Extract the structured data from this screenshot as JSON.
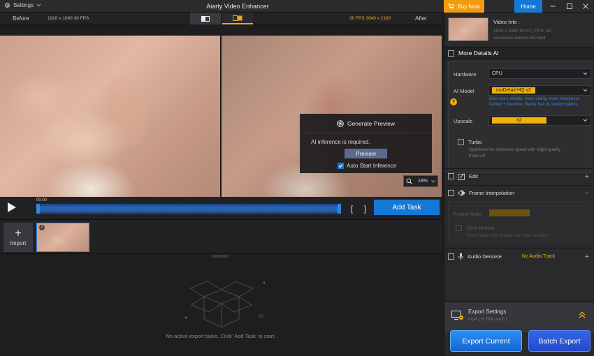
{
  "titlebar": {
    "settings_label": "Settings",
    "app_title": "Aiarty Video Enhancer",
    "buy_now_label": "Buy Now",
    "home_label": "Home"
  },
  "compare": {
    "before_label": "Before",
    "before_info": "1920 x 1080  30 FPS",
    "after_info": "30 FPS  3840 x 2160",
    "after_label": "After"
  },
  "preview_popup": {
    "title": "Generate Preview",
    "message": "AI inference is required.",
    "preview_button": "Preview",
    "auto_start_label": "Auto Start Inference",
    "auto_start_checked": true
  },
  "zoom": {
    "value": "18%"
  },
  "timeline": {
    "timecode": "00:00",
    "brackets": "[ ]",
    "add_task_label": "Add Task"
  },
  "media": {
    "import_label": "Import"
  },
  "export_area": {
    "empty_text": "No active export tasks. Click 'Add Task' to start."
  },
  "video_info": {
    "title": "Video Info :",
    "meta": "1920 x 1080  00:07  |  FPS: 30",
    "filename": "showcase-before-kid.mp4"
  },
  "more_details": {
    "title": "More Details AI",
    "hardware_label": "Hardware",
    "hardware_value": "CPU",
    "model_label": "AI Model",
    "model_value": "moDetail-HQ  v2",
    "model_desc_1": "Gen more details, more clarity, more sharpness",
    "model_desc_2": "Deblur + Denoise. Better hair & outdoor plants",
    "upscale_label": "Upscale",
    "upscale_value": "x2",
    "turbo_label": "Turbo",
    "turbo_desc_1": "Optimized for inference speed with slight quality",
    "turbo_desc_2": "trade-off"
  },
  "edit": {
    "label": "Edit"
  },
  "frame_interp": {
    "label": "Frame Interpolation",
    "frame_rate_label": "Frame Rate",
    "slow_motion_label": "Slow Motion",
    "slow_motion_desc": "Slow motion will change the video duration"
  },
  "audio_denoise": {
    "label": "Audio Denoise",
    "status": "No Audio Track"
  },
  "export_settings": {
    "title": "Export Settings",
    "subtitle": "mp4 [ H.264, AAC ]"
  },
  "export_buttons": {
    "current_label": "Export Current",
    "batch_label": "Batch Export"
  },
  "colors": {
    "accent_blue": "#1479d6",
    "buy_orange": "#f29b0c",
    "highlight_yellow": "#f0b10a"
  }
}
